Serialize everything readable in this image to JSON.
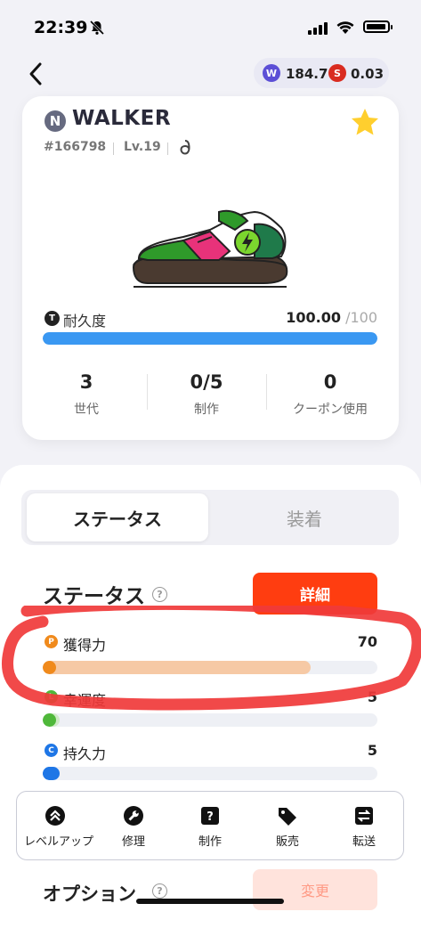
{
  "status_bar": {
    "time": "22:39"
  },
  "wallet": {
    "gst_icon": "W",
    "gst_balance": "184.7",
    "gmt_icon": "S",
    "gmt_balance": "0.03"
  },
  "shoe": {
    "quality_letter": "N",
    "name": "WALKER",
    "id": "#166798",
    "level": "Lv.19",
    "durability": {
      "icon_letter": "T",
      "label": "耐久度",
      "value": "100.00",
      "max": "/100",
      "fraction": 1.0
    },
    "stats": [
      {
        "value": "3",
        "label": "世代"
      },
      {
        "value": "0/5",
        "label": "制作"
      },
      {
        "value": "0",
        "label": "クーポン使用"
      }
    ]
  },
  "tabs": {
    "active": "ステータス",
    "inactive": "装着"
  },
  "status_section": {
    "title": "ステータス",
    "help_icon": "?",
    "detail_button": "詳細",
    "attributes": [
      {
        "icon": "P",
        "label": "獲得力",
        "value": "70",
        "fraction": 0.8,
        "color": "#f08a1c",
        "fill_color": "#f6c9a5"
      },
      {
        "icon": "L",
        "label": "幸運度",
        "value": "5",
        "fraction": 0.05,
        "color": "#4fb83a",
        "fill_color": "#cfeac6"
      },
      {
        "icon": "C",
        "label": "持久力",
        "value": "5",
        "fraction": 0.05,
        "color": "#1e76e6",
        "fill_color": "#1e76e6"
      }
    ]
  },
  "toolbar": [
    {
      "icon": "level-up-icon",
      "label": "レベルアップ"
    },
    {
      "icon": "wrench-icon",
      "label": "修理"
    },
    {
      "icon": "mint-box-icon",
      "label": "制作"
    },
    {
      "icon": "tag-icon",
      "label": "販売"
    },
    {
      "icon": "transfer-icon",
      "label": "転送"
    }
  ],
  "options_section": {
    "title": "オプション",
    "help_icon": "?",
    "change_button": "変更"
  },
  "colors": {
    "accent": "#ff3d10",
    "durability_bar": "#3a98f2",
    "annotation": "#f03a3a"
  }
}
